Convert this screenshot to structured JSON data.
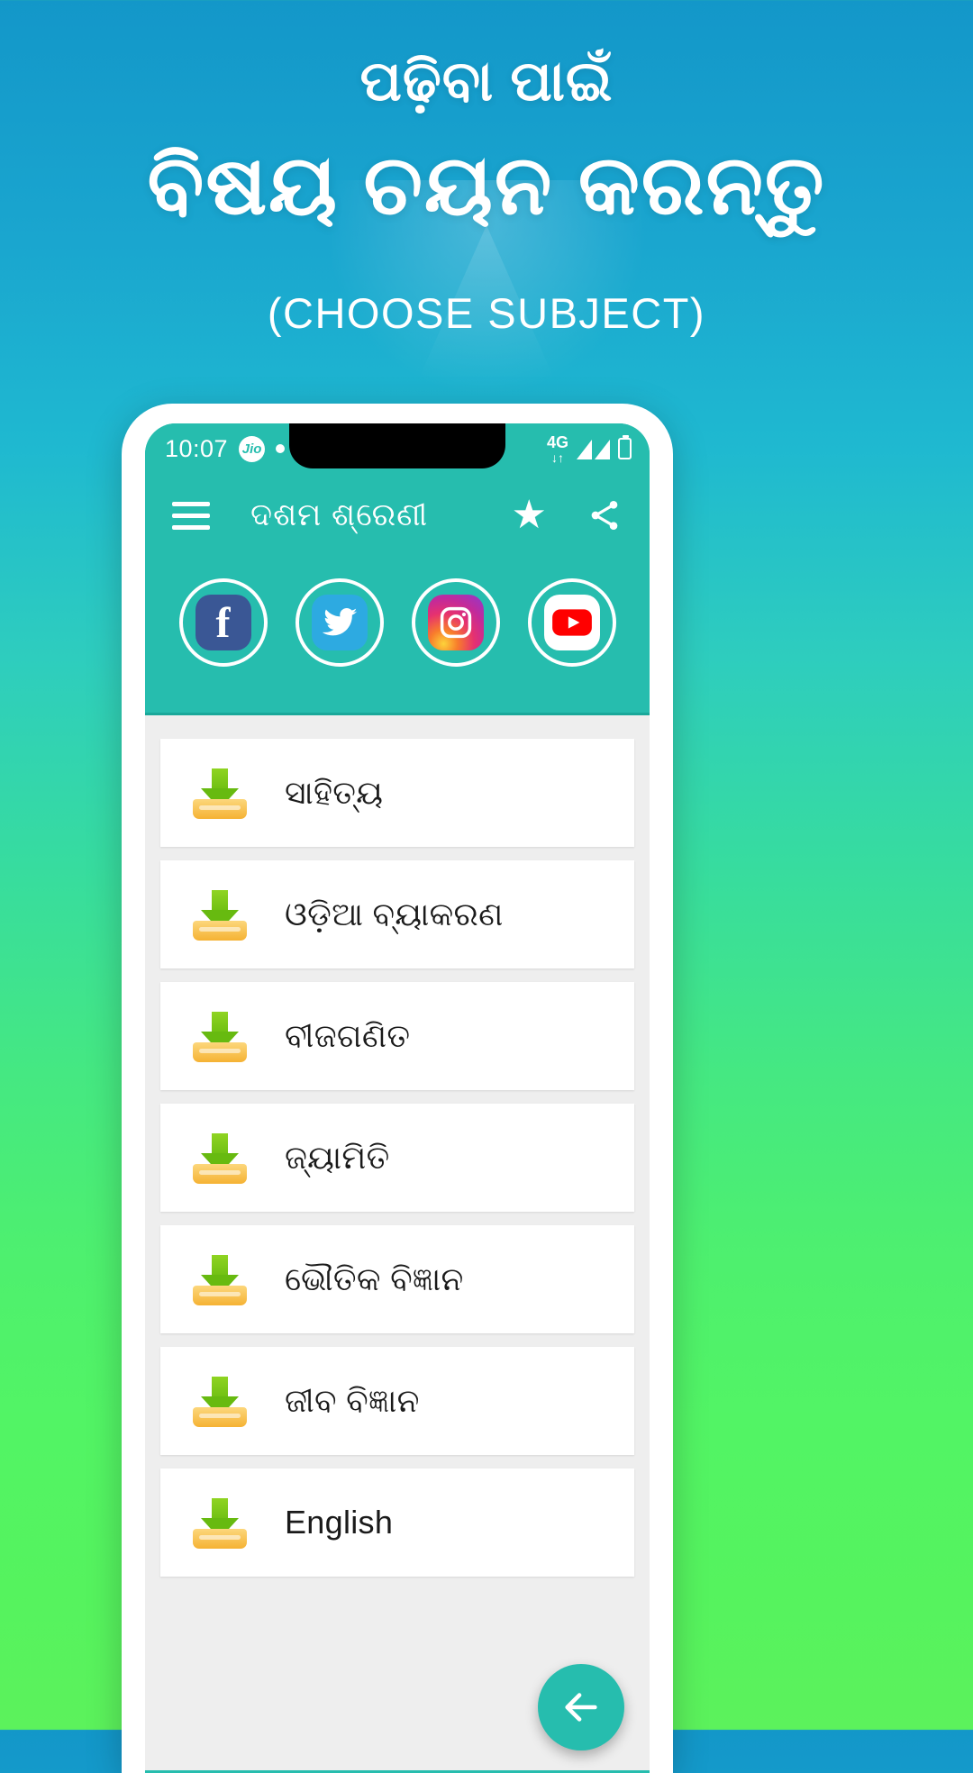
{
  "poster": {
    "headline_line1": "ପଢ଼ିବା ପାଇଁ",
    "headline_line2": "ବିଷୟ ଚୟନ କରନ୍ତୁ",
    "subtitle": "(CHOOSE SUBJECT)",
    "background_top_color": "#1397c9",
    "background_bottom_color": "#5cf25c"
  },
  "phone": {
    "status_bar": {
      "time": "10:07",
      "carrier": "Jio",
      "network": "4G",
      "network_arrows": "↓↑",
      "dot": "•"
    },
    "app_bar": {
      "menu_icon": "hamburger-icon",
      "title": "ଦଶମ  ଶ୍ରେଣୀ",
      "favorite_icon": "star-icon",
      "share_icon": "share-icon",
      "background_color": "#26bdae"
    },
    "social": [
      {
        "name": "facebook",
        "label": "f",
        "icon": "facebook-icon"
      },
      {
        "name": "twitter",
        "label": "",
        "icon": "twitter-icon"
      },
      {
        "name": "instagram",
        "label": "",
        "icon": "instagram-icon"
      },
      {
        "name": "youtube",
        "label": "",
        "icon": "youtube-icon"
      }
    ],
    "subjects": [
      {
        "label": "ସାହିତ୍ୟ",
        "icon": "download-icon"
      },
      {
        "label": "ଓଡ଼ିଆ ବ୍ୟାକରଣ",
        "icon": "download-icon"
      },
      {
        "label": "ବୀଜଗଣିତ",
        "icon": "download-icon"
      },
      {
        "label": "ଜ୍ୟାମିତି",
        "icon": "download-icon"
      },
      {
        "label": "ଭୌତିକ ବିଜ୍ଞାନ",
        "icon": "download-icon"
      },
      {
        "label": "ଜୀବ ବିଜ୍ଞାନ",
        "icon": "download-icon"
      },
      {
        "label": "English",
        "icon": "download-icon"
      }
    ],
    "fab": {
      "icon": "back-arrow-icon",
      "color": "#26bdae"
    }
  }
}
